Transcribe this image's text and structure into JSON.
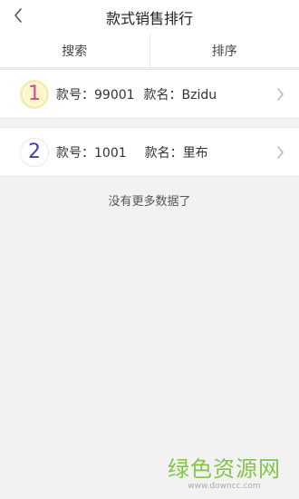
{
  "header": {
    "title": "款式销售排行",
    "back_icon": "chevron-left-icon"
  },
  "filters": {
    "search_label": "搜索",
    "sort_label": "排序"
  },
  "items": [
    {
      "rank": "1",
      "code_label": "款号：",
      "code": "99001",
      "name_label": "款名：",
      "name": "Bzidu"
    },
    {
      "rank": "2",
      "code_label": "款号：",
      "code": "1001",
      "name_label": "款名：",
      "name": "里布"
    }
  ],
  "status": {
    "empty_message": "没有更多数据了"
  },
  "watermark": {
    "main": "绿色资源网",
    "sub": "www.downcc.com"
  },
  "colors": {
    "rank_1": "#ea3e8a",
    "rank_2": "#3f3fb5",
    "watermark_green": "#86c34a"
  }
}
